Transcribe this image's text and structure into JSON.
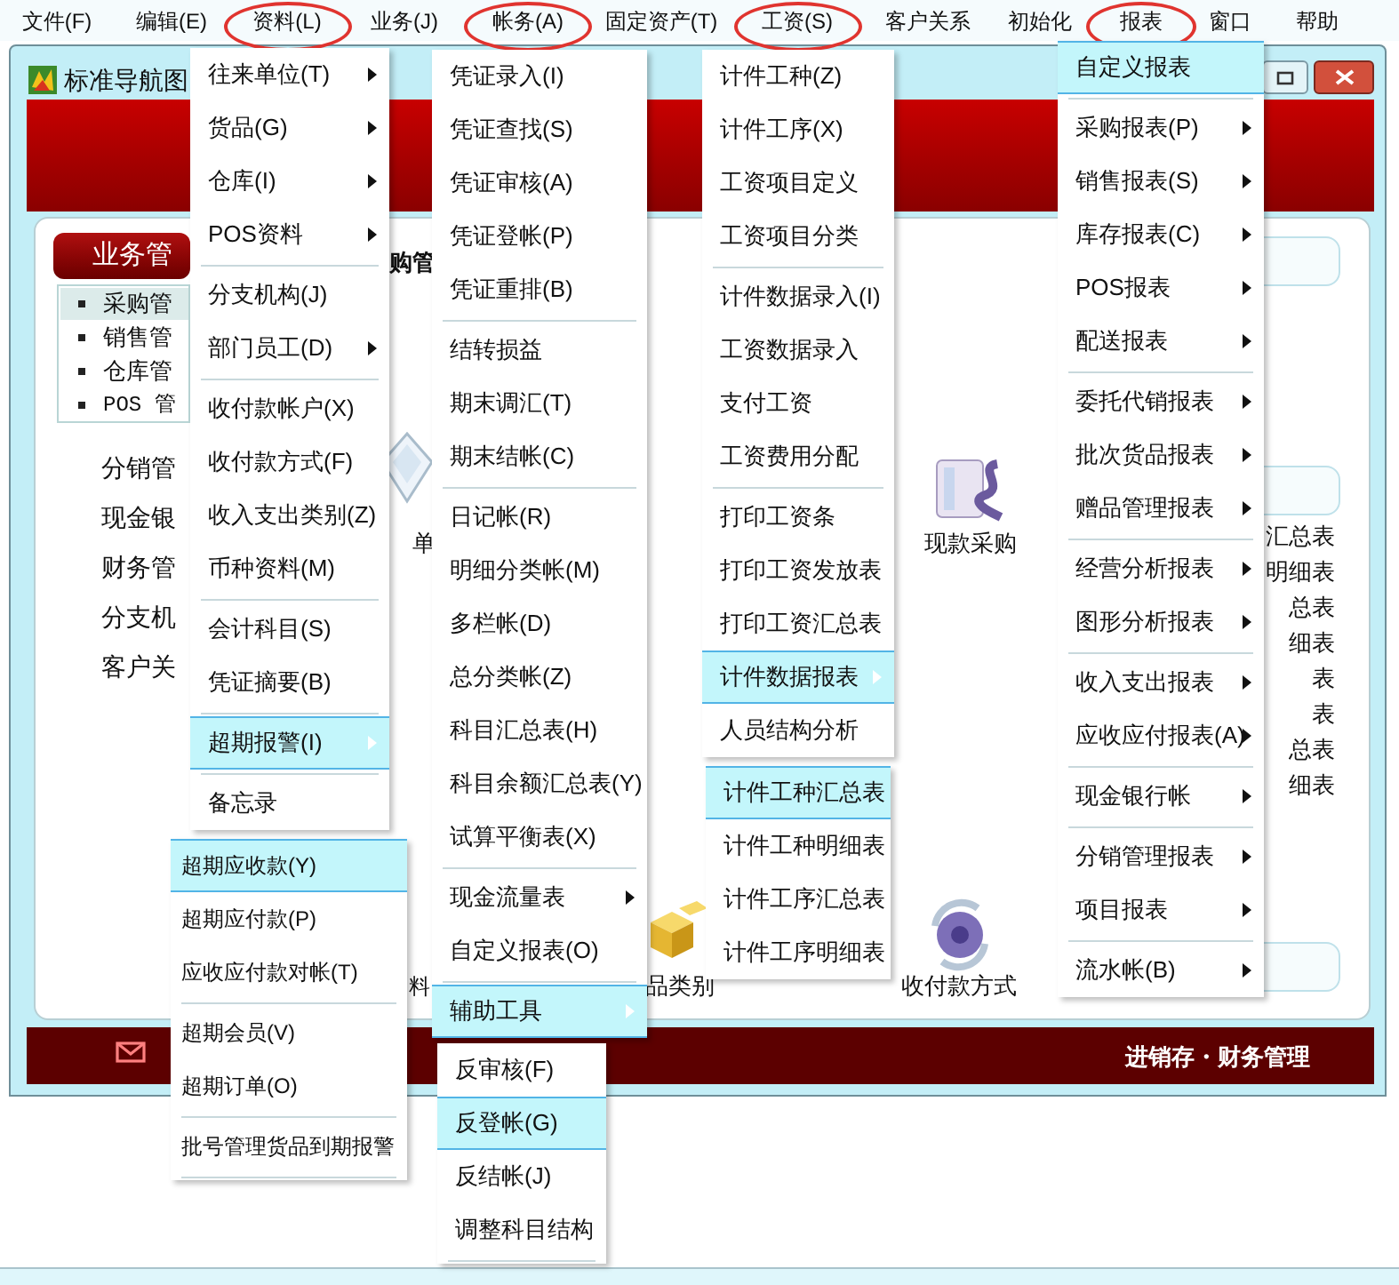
{
  "menubar": [
    {
      "label": "文件(F)",
      "circled": false
    },
    {
      "label": "编辑(E)",
      "circled": false
    },
    {
      "label": "资料(L)",
      "circled": true
    },
    {
      "label": "业务(J)",
      "circled": false
    },
    {
      "label": "帐务(A)",
      "circled": true
    },
    {
      "label": "固定资产(T)",
      "circled": false
    },
    {
      "label": "工资(S)",
      "circled": true
    },
    {
      "label": "客户关系",
      "circled": false
    },
    {
      "label": "初始化",
      "circled": false
    },
    {
      "label": "报表",
      "circled": true
    },
    {
      "label": "窗口",
      "circled": false
    },
    {
      "label": "帮助",
      "circled": false
    }
  ],
  "nav_window": {
    "title": "标准导航图",
    "section_button": "业务管",
    "section_list": [
      {
        "label": "采购管",
        "selected": true
      },
      {
        "label": "销售管",
        "selected": false
      },
      {
        "label": "仓库管",
        "selected": false
      },
      {
        "label": "POS 管",
        "selected": false
      }
    ],
    "sections": [
      "分销管",
      "现金银",
      "财务管",
      "分支机",
      "客户关"
    ],
    "heading": "购管",
    "shortcuts": [
      {
        "label": "单"
      },
      {
        "label": "现款采购"
      },
      {
        "label": "料"
      },
      {
        "label": "品类别"
      },
      {
        "label": "收付款方式"
      }
    ],
    "right_labels": [
      "汇总表",
      "明细表",
      "总表",
      "细表",
      "表",
      "表",
      "总表",
      "细表"
    ],
    "footer_title": "进销存・财务管理"
  },
  "menus": [
    {
      "items": [
        {
          "kind": "item",
          "label": "往来单位(T)",
          "submenu": true,
          "selected": false
        },
        {
          "kind": "item",
          "label": "货品(G)",
          "submenu": true,
          "selected": false
        },
        {
          "kind": "item",
          "label": "仓库(I)",
          "submenu": true,
          "selected": false
        },
        {
          "kind": "item",
          "label": "POS资料",
          "submenu": true,
          "selected": false
        },
        {
          "kind": "separator"
        },
        {
          "kind": "item",
          "label": "分支机构(J)",
          "submenu": false,
          "selected": false
        },
        {
          "kind": "item",
          "label": "部门员工(D)",
          "submenu": true,
          "selected": false
        },
        {
          "kind": "separator"
        },
        {
          "kind": "item",
          "label": "收付款帐户(X)",
          "submenu": false,
          "selected": false
        },
        {
          "kind": "item",
          "label": "收付款方式(F)",
          "submenu": false,
          "selected": false
        },
        {
          "kind": "item",
          "label": "收入支出类别(Z)",
          "submenu": false,
          "selected": false
        },
        {
          "kind": "item",
          "label": "币种资料(M)",
          "submenu": false,
          "selected": false
        },
        {
          "kind": "separator"
        },
        {
          "kind": "item",
          "label": "会计科目(S)",
          "submenu": false,
          "selected": false
        },
        {
          "kind": "item",
          "label": "凭证摘要(B)",
          "submenu": false,
          "selected": false
        },
        {
          "kind": "separator"
        },
        {
          "kind": "item",
          "label": "超期报警(I)",
          "submenu": true,
          "selected": true
        },
        {
          "kind": "separator"
        },
        {
          "kind": "item",
          "label": "备忘录",
          "submenu": false,
          "selected": false
        }
      ]
    },
    {
      "items": [
        {
          "kind": "item",
          "label": "超期应收款(Y)",
          "submenu": false,
          "selected": true
        },
        {
          "kind": "item",
          "label": "超期应付款(P)",
          "submenu": false,
          "selected": false
        },
        {
          "kind": "item",
          "label": "应收应付款对帐(T)",
          "submenu": false,
          "selected": false
        },
        {
          "kind": "separator"
        },
        {
          "kind": "item",
          "label": "超期会员(V)",
          "submenu": false,
          "selected": false
        },
        {
          "kind": "item",
          "label": "超期订单(O)",
          "submenu": false,
          "selected": false
        },
        {
          "kind": "separator"
        },
        {
          "kind": "item",
          "label": "批号管理货品到期报警",
          "submenu": false,
          "selected": false
        },
        {
          "kind": "separator"
        }
      ]
    },
    {
      "items": [
        {
          "kind": "item",
          "label": "凭证录入(I)",
          "submenu": false,
          "selected": false
        },
        {
          "kind": "item",
          "label": "凭证查找(S)",
          "submenu": false,
          "selected": false
        },
        {
          "kind": "item",
          "label": "凭证审核(A)",
          "submenu": false,
          "selected": false
        },
        {
          "kind": "item",
          "label": "凭证登帐(P)",
          "submenu": false,
          "selected": false
        },
        {
          "kind": "item",
          "label": "凭证重排(B)",
          "submenu": false,
          "selected": false
        },
        {
          "kind": "separator"
        },
        {
          "kind": "item",
          "label": "结转损益",
          "submenu": false,
          "selected": false
        },
        {
          "kind": "item",
          "label": "期末调汇(T)",
          "submenu": false,
          "selected": false
        },
        {
          "kind": "item",
          "label": "期末结帐(C)",
          "submenu": false,
          "selected": false
        },
        {
          "kind": "separator"
        },
        {
          "kind": "item",
          "label": "日记帐(R)",
          "submenu": false,
          "selected": false
        },
        {
          "kind": "item",
          "label": "明细分类帐(M)",
          "submenu": false,
          "selected": false
        },
        {
          "kind": "item",
          "label": "多栏帐(D)",
          "submenu": false,
          "selected": false
        },
        {
          "kind": "item",
          "label": "总分类帐(Z)",
          "submenu": false,
          "selected": false
        },
        {
          "kind": "item",
          "label": "科目汇总表(H)",
          "submenu": false,
          "selected": false
        },
        {
          "kind": "item",
          "label": "科目余额汇总表(Y)",
          "submenu": false,
          "selected": false
        },
        {
          "kind": "item",
          "label": "试算平衡表(X)",
          "submenu": false,
          "selected": false
        },
        {
          "kind": "separator"
        },
        {
          "kind": "item",
          "label": "现金流量表",
          "submenu": true,
          "selected": false
        },
        {
          "kind": "item",
          "label": "自定义报表(O)",
          "submenu": false,
          "selected": false
        },
        {
          "kind": "separator"
        },
        {
          "kind": "item",
          "label": "辅助工具",
          "submenu": true,
          "selected": true
        }
      ]
    },
    {
      "items": [
        {
          "kind": "item",
          "label": "反审核(F)",
          "submenu": false,
          "selected": false
        },
        {
          "kind": "item",
          "label": "反登帐(G)",
          "submenu": false,
          "selected": true
        },
        {
          "kind": "item",
          "label": "反结帐(J)",
          "submenu": false,
          "selected": false
        },
        {
          "kind": "item",
          "label": "调整科目结构",
          "submenu": false,
          "selected": false
        },
        {
          "kind": "separator"
        }
      ]
    },
    {
      "items": [
        {
          "kind": "item",
          "label": "计件工种(Z)",
          "submenu": false,
          "selected": false
        },
        {
          "kind": "item",
          "label": "计件工序(X)",
          "submenu": false,
          "selected": false
        },
        {
          "kind": "item",
          "label": "工资项目定义",
          "submenu": false,
          "selected": false
        },
        {
          "kind": "item",
          "label": "工资项目分类",
          "submenu": false,
          "selected": false
        },
        {
          "kind": "separator"
        },
        {
          "kind": "item",
          "label": "计件数据录入(I)",
          "submenu": false,
          "selected": false
        },
        {
          "kind": "item",
          "label": "工资数据录入",
          "submenu": false,
          "selected": false
        },
        {
          "kind": "item",
          "label": "支付工资",
          "submenu": false,
          "selected": false
        },
        {
          "kind": "item",
          "label": "工资费用分配",
          "submenu": false,
          "selected": false
        },
        {
          "kind": "separator"
        },
        {
          "kind": "item",
          "label": "打印工资条",
          "submenu": false,
          "selected": false
        },
        {
          "kind": "item",
          "label": "打印工资发放表",
          "submenu": false,
          "selected": false
        },
        {
          "kind": "item",
          "label": "打印工资汇总表",
          "submenu": false,
          "selected": false
        },
        {
          "kind": "item",
          "label": "计件数据报表",
          "submenu": true,
          "selected": true
        },
        {
          "kind": "item",
          "label": "人员结构分析",
          "submenu": false,
          "selected": false
        }
      ]
    },
    {
      "items": [
        {
          "kind": "item",
          "label": "计件工种汇总表",
          "submenu": false,
          "selected": true
        },
        {
          "kind": "item",
          "label": "计件工种明细表",
          "submenu": false,
          "selected": false
        },
        {
          "kind": "item",
          "label": "计件工序汇总表",
          "submenu": false,
          "selected": false
        },
        {
          "kind": "item",
          "label": "计件工序明细表",
          "submenu": false,
          "selected": false
        }
      ]
    },
    {
      "items": [
        {
          "kind": "item",
          "label": "自定义报表",
          "submenu": false,
          "selected": true
        },
        {
          "kind": "separator"
        },
        {
          "kind": "item",
          "label": "采购报表(P)",
          "submenu": true,
          "selected": false
        },
        {
          "kind": "item",
          "label": "销售报表(S)",
          "submenu": true,
          "selected": false
        },
        {
          "kind": "item",
          "label": "库存报表(C)",
          "submenu": true,
          "selected": false
        },
        {
          "kind": "item",
          "label": "POS报表",
          "submenu": true,
          "selected": false
        },
        {
          "kind": "item",
          "label": "配送报表",
          "submenu": true,
          "selected": false
        },
        {
          "kind": "separator"
        },
        {
          "kind": "item",
          "label": "委托代销报表",
          "submenu": true,
          "selected": false
        },
        {
          "kind": "item",
          "label": "批次货品报表",
          "submenu": true,
          "selected": false
        },
        {
          "kind": "item",
          "label": "赠品管理报表",
          "submenu": true,
          "selected": false
        },
        {
          "kind": "separator"
        },
        {
          "kind": "item",
          "label": "经营分析报表",
          "submenu": true,
          "selected": false
        },
        {
          "kind": "item",
          "label": "图形分析报表",
          "submenu": true,
          "selected": false
        },
        {
          "kind": "separator"
        },
        {
          "kind": "item",
          "label": "收入支出报表",
          "submenu": true,
          "selected": false
        },
        {
          "kind": "item",
          "label": "应收应付报表(A)",
          "submenu": true,
          "selected": false
        },
        {
          "kind": "separator"
        },
        {
          "kind": "item",
          "label": "现金银行帐",
          "submenu": true,
          "selected": false
        },
        {
          "kind": "separator"
        },
        {
          "kind": "item",
          "label": "分销管理报表",
          "submenu": true,
          "selected": false
        },
        {
          "kind": "item",
          "label": "项目报表",
          "submenu": true,
          "selected": false
        },
        {
          "kind": "separator"
        },
        {
          "kind": "item",
          "label": "流水帐(B)",
          "submenu": true,
          "selected": false
        }
      ]
    }
  ]
}
